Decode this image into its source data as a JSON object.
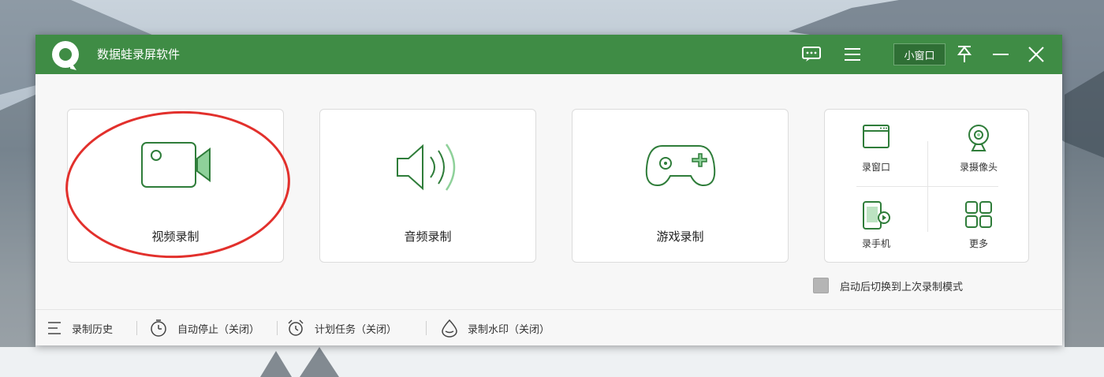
{
  "app": {
    "title": "数据蛙录屏软件",
    "accent": "#3f8c45",
    "mini_window_label": "小窗口"
  },
  "titlebar_icons": [
    "feedback-icon",
    "menu-icon",
    "pin-icon",
    "minimize-icon",
    "close-icon"
  ],
  "modes": [
    {
      "label": "视频录制",
      "icon": "video-camera-icon",
      "highlighted": true
    },
    {
      "label": "音频录制",
      "icon": "speaker-icon"
    },
    {
      "label": "游戏录制",
      "icon": "gamepad-icon"
    }
  ],
  "more_grid": [
    {
      "label": "录窗口",
      "icon": "window-icon"
    },
    {
      "label": "录摄像头",
      "icon": "webcam-icon"
    },
    {
      "label": "录手机",
      "icon": "phone-icon"
    },
    {
      "label": "更多",
      "icon": "grid-icon"
    }
  ],
  "remember_option": {
    "label": "启动后切换到上次录制模式",
    "checked": false
  },
  "footer": [
    {
      "label": "录制历史",
      "icon": "history-list-icon"
    },
    {
      "label": "自动停止（关闭）",
      "icon": "timer-icon"
    },
    {
      "label": "计划任务（关闭）",
      "icon": "alarm-clock-icon"
    },
    {
      "label": "录制水印（关闭）",
      "icon": "watermark-drop-icon"
    }
  ],
  "highlight_color": "#e2302c"
}
